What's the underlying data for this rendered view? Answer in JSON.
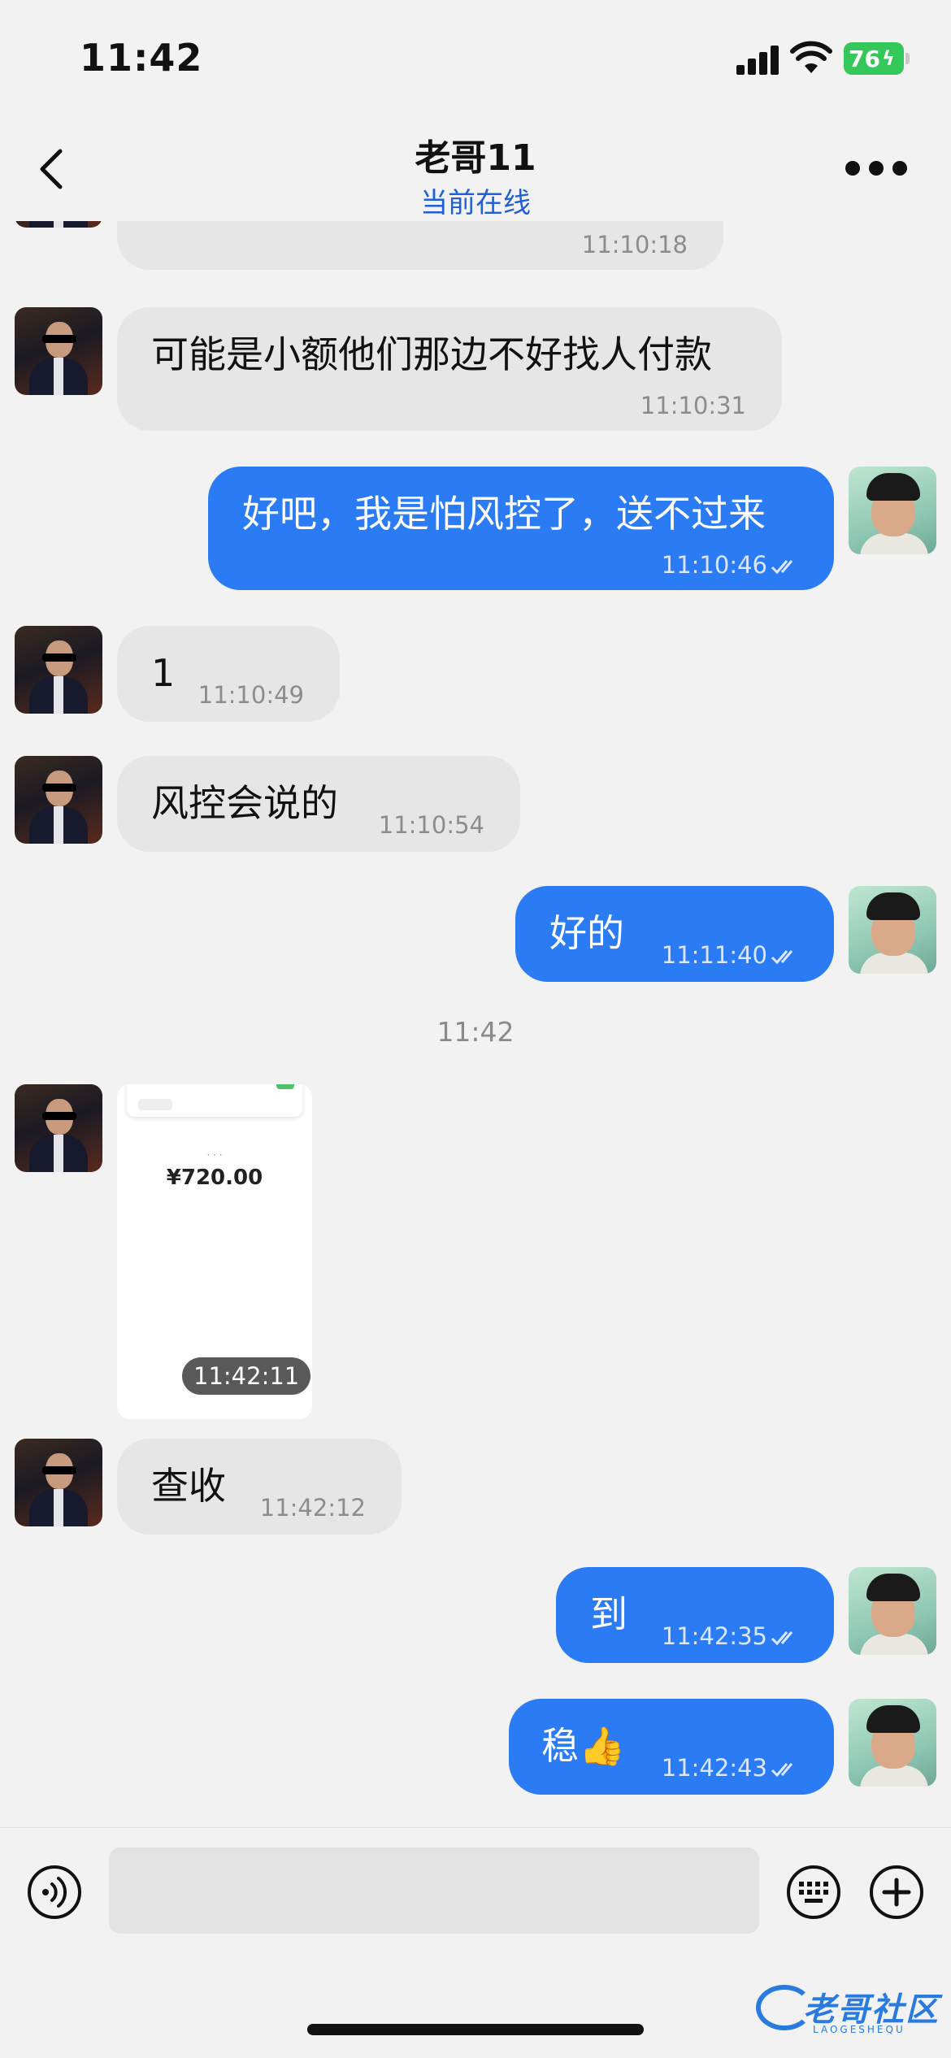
{
  "status_bar": {
    "time": "11:42",
    "battery": "76"
  },
  "header": {
    "title": "老哥11",
    "subtitle": "当前在线"
  },
  "messages": [
    {
      "dir": "in",
      "text": "",
      "time": "11:10:18"
    },
    {
      "dir": "in",
      "text": "可能是小额他们那边不好找人付款",
      "time": "11:10:31"
    },
    {
      "dir": "out",
      "text": "好吧，我是怕风控了，送不过来",
      "time": "11:10:46"
    },
    {
      "dir": "in",
      "text": "1",
      "time": "11:10:49"
    },
    {
      "dir": "in",
      "text": "风控会说的",
      "time": "11:10:54"
    },
    {
      "dir": "out",
      "text": "好的",
      "time": "11:11:40"
    },
    {
      "dir": "in",
      "text": "查收",
      "time": "11:42:12"
    },
    {
      "dir": "out",
      "text": "到",
      "time": "11:42:35"
    },
    {
      "dir": "out",
      "text": "稳👍",
      "time": "11:42:43"
    }
  ],
  "divider": "11:42",
  "image_message": {
    "amount": "¥720.00",
    "time": "11:42:11"
  },
  "watermark": {
    "text": "老哥社区",
    "sub": "LAOGESHEQU"
  },
  "colors": {
    "outgoing": "#2b7bf5",
    "incoming": "#e6e6e6",
    "accent": "#1f5fd8",
    "battery": "#34c759"
  },
  "icons": [
    "back-chevron-icon",
    "more-dots-icon",
    "voice-icon",
    "keyboard-icon",
    "plus-icon",
    "double-check-icon",
    "signal-icon",
    "wifi-icon",
    "battery-icon"
  ]
}
